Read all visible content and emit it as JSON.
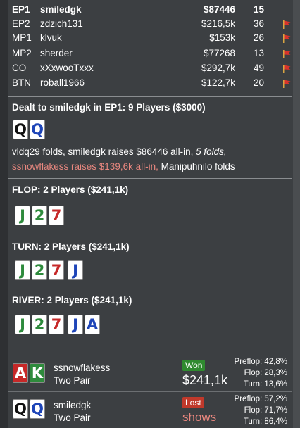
{
  "players": [
    {
      "pos": "EP1",
      "name": "smiledgk",
      "stack": "$87446",
      "hands": "15",
      "bold": true,
      "flag": false
    },
    {
      "pos": "EP2",
      "name": "zdzich131",
      "stack": "$216,5k",
      "hands": "36",
      "bold": false,
      "flag": true
    },
    {
      "pos": "MP1",
      "name": "klvuk",
      "stack": "$153k",
      "hands": "26",
      "bold": false,
      "flag": true
    },
    {
      "pos": "MP2",
      "name": "sherder",
      "stack": "$77268",
      "hands": "13",
      "bold": false,
      "flag": true
    },
    {
      "pos": "CO",
      "name": "xXxwooTxxx",
      "stack": "$292,7k",
      "hands": "49",
      "bold": false,
      "flag": true
    },
    {
      "pos": "BTN",
      "name": "roball1966",
      "stack": "$122,7k",
      "hands": "20",
      "bold": false,
      "flag": true
    }
  ],
  "preflop": {
    "title": "Dealt to smiledgk in EP1: 9 Players ($3000)",
    "cards": [
      {
        "rank": "Q",
        "suit": "spade"
      },
      {
        "rank": "Q",
        "suit": "diamond"
      }
    ],
    "actions": {
      "a1": "vldq29 folds, smiledgk raises $86446 all-in, ",
      "a2": "5 folds,",
      "a3": "ssnowflakess raises $139,6k all-in,",
      "a4": " Manipuhnilo folds"
    }
  },
  "flop": {
    "title": "FLOP: 2 Players ($241,1k)",
    "cards": [
      {
        "rank": "J",
        "suit": "club"
      },
      {
        "rank": "2",
        "suit": "club"
      },
      {
        "rank": "7",
        "suit": "heart"
      }
    ]
  },
  "turn": {
    "title": "TURN: 2 Players ($241,1k)",
    "cards": [
      {
        "rank": "J",
        "suit": "club"
      },
      {
        "rank": "2",
        "suit": "club"
      },
      {
        "rank": "7",
        "suit": "heart"
      },
      {
        "rank": "J",
        "suit": "diamond"
      }
    ]
  },
  "river": {
    "title": "RIVER: 2 Players ($241,1k)",
    "cards": [
      {
        "rank": "J",
        "suit": "club"
      },
      {
        "rank": "2",
        "suit": "club"
      },
      {
        "rank": "7",
        "suit": "heart"
      },
      {
        "rank": "J",
        "suit": "diamond"
      },
      {
        "rank": "A",
        "suit": "diamond"
      }
    ]
  },
  "showdown": [
    {
      "name": "ssnowflakess",
      "hand": "Two Pair",
      "badge": "Won",
      "result": "$241,1k",
      "cards": [
        {
          "rank": "A",
          "suit": "bg-heart"
        },
        {
          "rank": "K",
          "suit": "bg-club"
        }
      ],
      "equity": {
        "preflop_label": "Preflop:",
        "preflop": "42,8%",
        "flop_label": "Flop:",
        "flop": "28,3%",
        "turn_label": "Turn:",
        "turn": "13,6%"
      }
    },
    {
      "name": "smiledgk",
      "hand": "Two Pair",
      "badge": "Lost",
      "result": "shows",
      "cards": [
        {
          "rank": "Q",
          "suit": "spade"
        },
        {
          "rank": "Q",
          "suit": "diamond"
        }
      ],
      "equity": {
        "preflop_label": "Preflop:",
        "preflop": "57,2%",
        "flop_label": "Flop:",
        "flop": "71,7%",
        "turn_label": "Turn:",
        "turn": "86,4%"
      }
    }
  ],
  "colors": {
    "background": "#3c3f42",
    "won": "#2f8a2f",
    "lost": "#c0392b",
    "red_text": "#e8877f"
  }
}
